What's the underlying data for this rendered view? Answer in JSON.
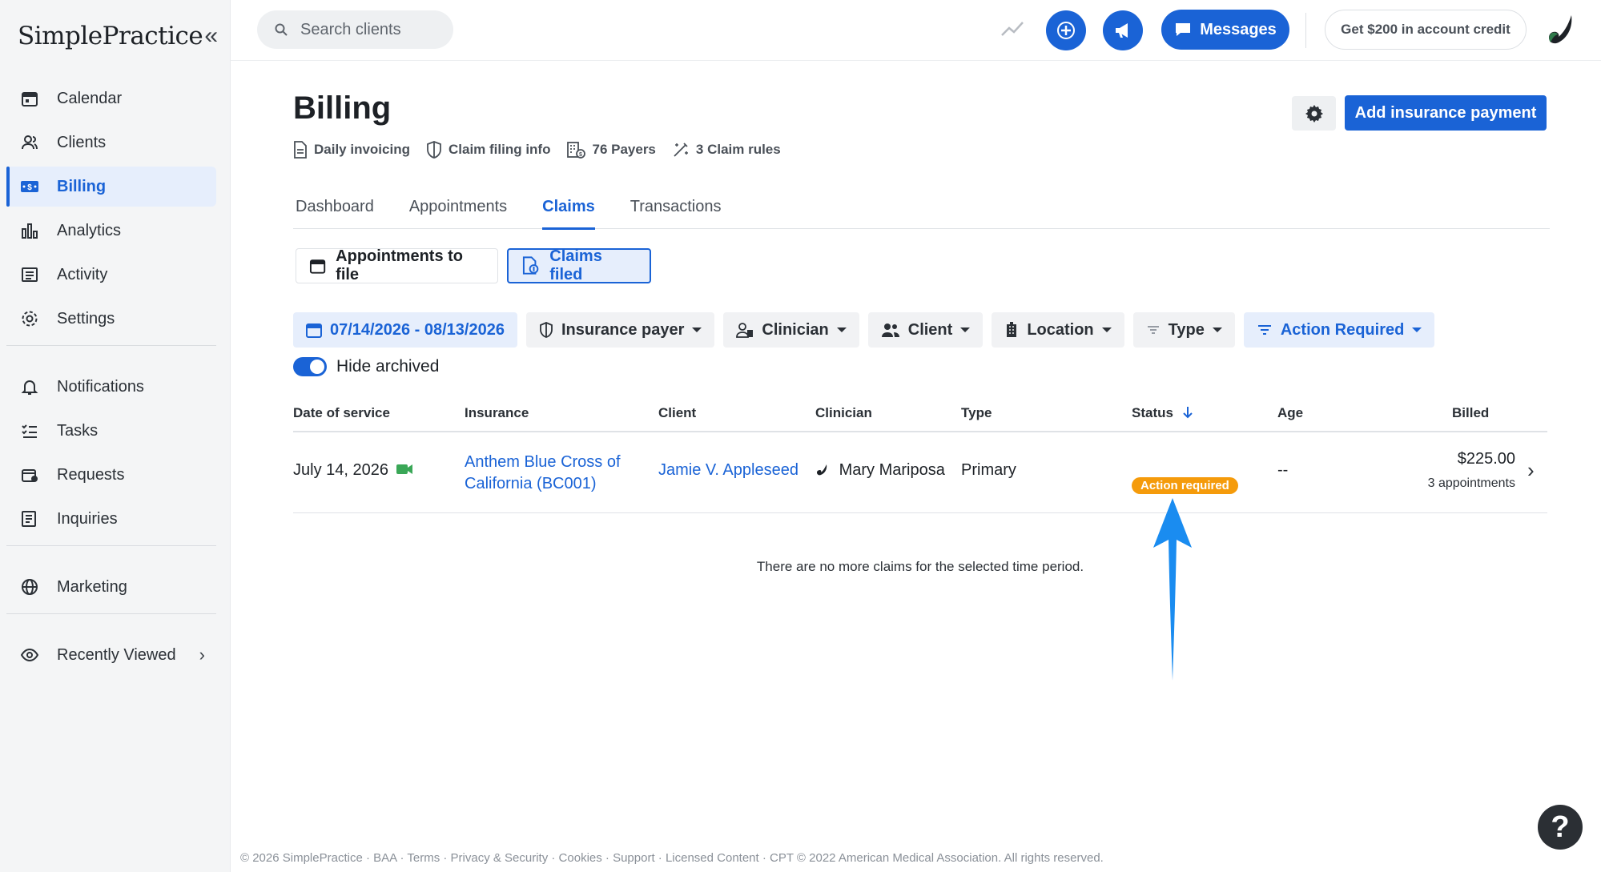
{
  "app": {
    "logo": "SimplePractice",
    "collapse_glyph": "«"
  },
  "sidebar": {
    "items": [
      {
        "label": "Calendar",
        "icon": "calendar-icon"
      },
      {
        "label": "Clients",
        "icon": "clients-icon"
      },
      {
        "label": "Billing",
        "icon": "billing-icon",
        "active": true
      },
      {
        "label": "Analytics",
        "icon": "analytics-icon"
      },
      {
        "label": "Activity",
        "icon": "activity-icon"
      },
      {
        "label": "Settings",
        "icon": "settings-icon"
      }
    ],
    "items2": [
      {
        "label": "Notifications",
        "icon": "bell-icon"
      },
      {
        "label": "Tasks",
        "icon": "tasks-icon"
      },
      {
        "label": "Requests",
        "icon": "requests-icon"
      },
      {
        "label": "Inquiries",
        "icon": "inquiries-icon"
      }
    ],
    "marketing": "Marketing",
    "recently_viewed": "Recently Viewed"
  },
  "header": {
    "search_placeholder": "Search clients",
    "messages_label": "Messages",
    "credit_label": "Get $200 in account credit"
  },
  "page": {
    "title": "Billing",
    "meta": [
      "Daily invoicing",
      "Claim filing info",
      "76 Payers",
      "3 Claim rules"
    ],
    "add_payment_label": "Add insurance payment",
    "tabs": [
      "Dashboard",
      "Appointments",
      "Claims",
      "Transactions"
    ],
    "active_tab": "Claims",
    "segments": {
      "appointments_to_file": "Appointments to file",
      "claims_filed": "Claims filed"
    },
    "filters": {
      "date_range": "07/14/2026 - 08/13/2026",
      "insurance_payer": "Insurance payer",
      "clinician": "Clinician",
      "client": "Client",
      "location": "Location",
      "type": "Type",
      "action_required": "Action Required"
    },
    "hide_archived": "Hide archived"
  },
  "table": {
    "headers": {
      "date": "Date of service",
      "insurance": "Insurance",
      "client": "Client",
      "clinician": "Clinician",
      "type": "Type",
      "status": "Status",
      "age": "Age",
      "billed": "Billed"
    },
    "row": {
      "date": "July 14, 2026",
      "insurance_line1": "Anthem Blue Cross of",
      "insurance_line2": "California (BC001)",
      "client": "Jamie V. Appleseed",
      "clinician": "Mary Mariposa",
      "type": "Primary",
      "status": "Action required",
      "age": "--",
      "billed": "$225.00",
      "appointments": "3 appointments"
    },
    "empty_message": "There are no more claims for the selected time period."
  },
  "footer": {
    "text": "© 2026 SimplePractice · BAA · Terms · Privacy & Security · Cookies · Support · Licensed Content · CPT © 2022 American Medical Association. All rights reserved."
  },
  "colors": {
    "brand_blue": "#1a63d6",
    "warning_orange": "#f59b0b",
    "annotation_arrow": "#1a8cf0"
  }
}
